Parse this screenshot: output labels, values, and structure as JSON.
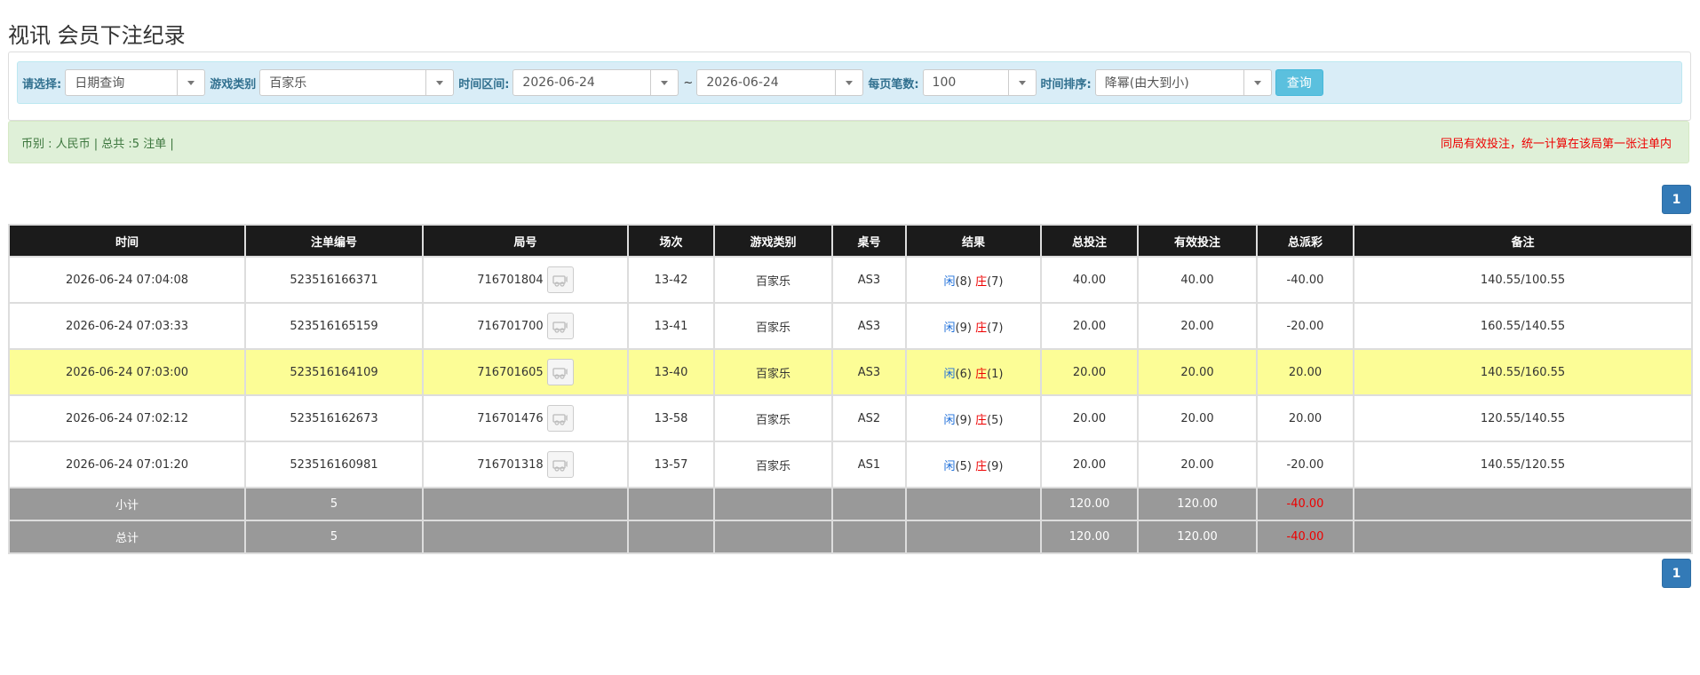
{
  "title": "视讯 会员下注纪录",
  "filters": {
    "select_label": "请选择:",
    "select_value": "日期查询",
    "game_type_label": "游戏类别",
    "game_type_value": "百家乐",
    "range_label": "时间区间:",
    "date_from": "2026-06-24",
    "tilde": "~",
    "date_to": "2026-06-24",
    "per_page_label": "每页笔数:",
    "per_page_value": "100",
    "sort_label": "时间排序:",
    "sort_value": "降幂(由大到小)",
    "query_button": "查询"
  },
  "info": {
    "left": "币别 : 人民币 | 总共 :5 注单 |",
    "right": "同局有效投注，统一计算在该局第一张注单内"
  },
  "pager": {
    "current": "1"
  },
  "table": {
    "columns": [
      "时间",
      "注单编号",
      "局号",
      "场次",
      "游戏类别",
      "桌号",
      "结果",
      "总投注",
      "有效投注",
      "总派彩",
      "备注"
    ],
    "rows": [
      {
        "time": "2026-06-24 07:04:08",
        "bet_no": "523516166371",
        "round": "716701804",
        "session": "13-42",
        "game": "百家乐",
        "table": "AS3",
        "player": "闲",
        "player_pts": "(8)",
        "banker": "庄",
        "banker_pts": "(7)",
        "total": "40.00",
        "valid": "40.00",
        "payout": "-40.00",
        "payout_neg": true,
        "note": "140.55/100.55",
        "highlight": false
      },
      {
        "time": "2026-06-24 07:03:33",
        "bet_no": "523516165159",
        "round": "716701700",
        "session": "13-41",
        "game": "百家乐",
        "table": "AS3",
        "player": "闲",
        "player_pts": "(9)",
        "banker": "庄",
        "banker_pts": "(7)",
        "total": "20.00",
        "valid": "20.00",
        "payout": "-20.00",
        "payout_neg": true,
        "note": "160.55/140.55",
        "highlight": false
      },
      {
        "time": "2026-06-24 07:03:00",
        "bet_no": "523516164109",
        "round": "716701605",
        "session": "13-40",
        "game": "百家乐",
        "table": "AS3",
        "player": "闲",
        "player_pts": "(6)",
        "banker": "庄",
        "banker_pts": "(1)",
        "total": "20.00",
        "valid": "20.00",
        "payout": "20.00",
        "payout_neg": false,
        "note": "140.55/160.55",
        "highlight": true
      },
      {
        "time": "2026-06-24 07:02:12",
        "bet_no": "523516162673",
        "round": "716701476",
        "session": "13-58",
        "game": "百家乐",
        "table": "AS2",
        "player": "闲",
        "player_pts": "(9)",
        "banker": "庄",
        "banker_pts": "(5)",
        "total": "20.00",
        "valid": "20.00",
        "payout": "20.00",
        "payout_neg": false,
        "note": "120.55/140.55",
        "highlight": false
      },
      {
        "time": "2026-06-24 07:01:20",
        "bet_no": "523516160981",
        "round": "716701318",
        "session": "13-57",
        "game": "百家乐",
        "table": "AS1",
        "player": "闲",
        "player_pts": "(5)",
        "banker": "庄",
        "banker_pts": "(9)",
        "total": "20.00",
        "valid": "20.00",
        "payout": "-20.00",
        "payout_neg": true,
        "note": "140.55/120.55",
        "highlight": false
      }
    ],
    "subtotal": {
      "label": "小计",
      "count": "5",
      "total": "120.00",
      "valid": "120.00",
      "payout": "-40.00"
    },
    "grandtotal": {
      "label": "总计",
      "count": "5",
      "total": "120.00",
      "valid": "120.00",
      "payout": "-40.00"
    }
  },
  "colors": {
    "header_bg": "#1b1b1b",
    "highlight_row": "#fcfd96",
    "summary_bg": "#999999",
    "negative": "#ee0000",
    "bet_amount": "#1e6fd9",
    "pager": "#337ab7"
  }
}
